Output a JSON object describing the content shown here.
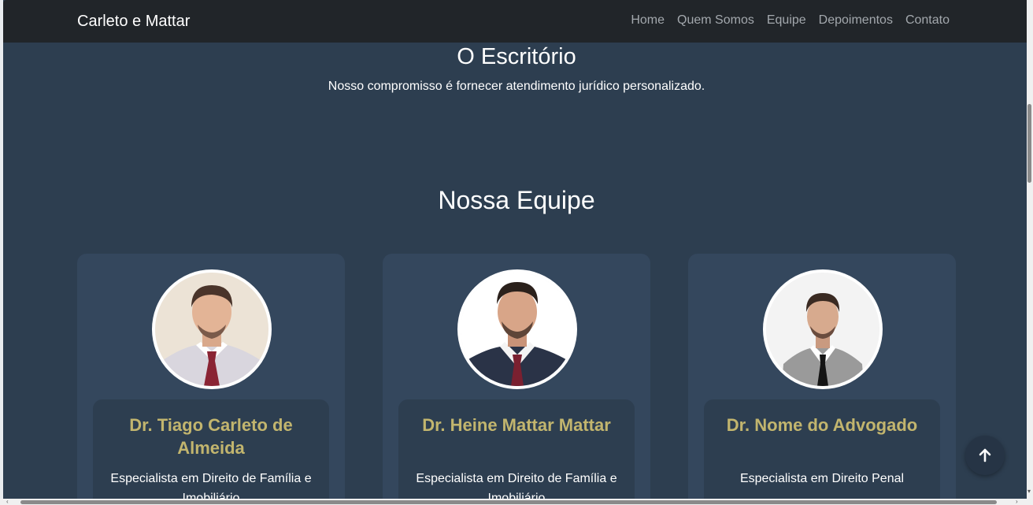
{
  "navbar": {
    "brand": "Carleto e Mattar",
    "links": [
      "Home",
      "Quem Somos",
      "Equipe",
      "Depoimentos",
      "Contato"
    ]
  },
  "office": {
    "title": "O Escritório",
    "text": "Nosso compromisso é fornecer atendimento jurídico personalizado."
  },
  "team": {
    "title": "Nossa Equipe",
    "members": [
      {
        "name": "Dr. Tiago Carleto de Almeida",
        "specialty": "Especialista em Direito de Família e Imobiliário"
      },
      {
        "name": "Dr. Heine Mattar Mattar",
        "specialty": "Especialista em Direito de Família e Imobiliário"
      },
      {
        "name": "Dr. Nome do Advogado",
        "specialty": "Especialista em Direito Penal"
      }
    ]
  },
  "back_to_top": {
    "icon": "arrow-up-icon"
  },
  "colors": {
    "navbar_bg": "#212529",
    "page_bg": "#2d3e50",
    "card_bg": "#34475d",
    "name_color": "#c2b56e"
  }
}
